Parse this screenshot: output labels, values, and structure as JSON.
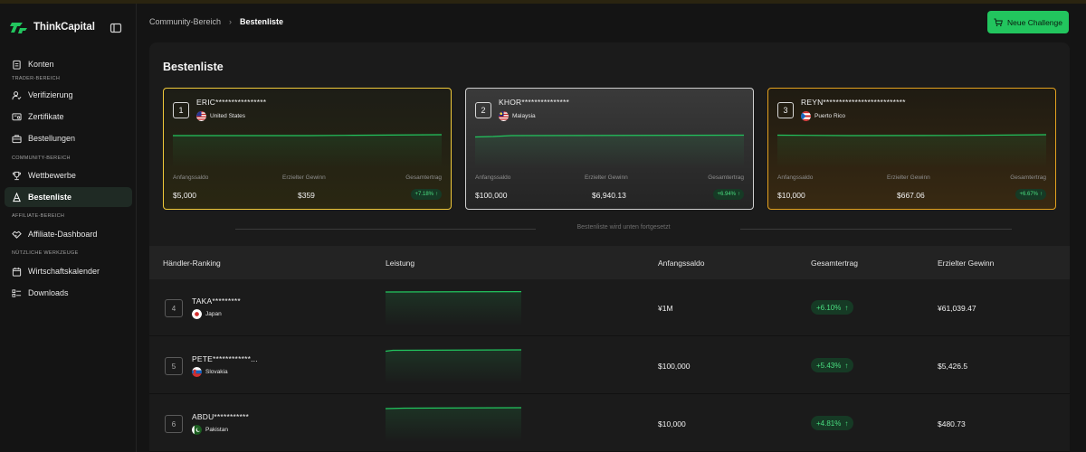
{
  "app": {
    "name": "ThinkCapital"
  },
  "sidebar": {
    "items": [
      {
        "label": "Konten",
        "icon": "clipboard-icon"
      },
      {
        "label": "Verifizierung",
        "icon": "user-check-icon"
      },
      {
        "label": "Zertifikate",
        "icon": "certificate-icon"
      },
      {
        "label": "Bestellungen",
        "icon": "briefcase-icon"
      },
      {
        "label": "Wettbewerbe",
        "icon": "trophy-icon"
      },
      {
        "label": "Bestenliste",
        "icon": "podium-icon",
        "active": true
      },
      {
        "label": "Affiliate-Dashboard",
        "icon": "handshake-icon"
      },
      {
        "label": "Wirtschaftskalender",
        "icon": "calendar-icon"
      },
      {
        "label": "Downloads",
        "icon": "list-icon"
      }
    ],
    "sections": [
      "TRADER-BEREICH",
      "COMMUNITY-BEREICH",
      "AFFILIATE-BEREICH",
      "NÜTZLICHE WERKZEUGE"
    ]
  },
  "breadcrumb": {
    "parent": "Community-Bereich",
    "current": "Bestenliste"
  },
  "new_challenge_label": "Neue Challenge",
  "page_title": "Bestenliste",
  "podium_labels": {
    "start": "Anfangssaldo",
    "profit": "Erzielter Gewinn",
    "return": "Gesamtertrag"
  },
  "top3": [
    {
      "rank": "1",
      "name": "ERIC****************",
      "country": "United States",
      "start": "$5,000",
      "profit": "$359",
      "return": "+7.18%"
    },
    {
      "rank": "2",
      "name": "KHOR***************",
      "country": "Malaysia",
      "start": "$100,000",
      "profit": "$6,940.13",
      "return": "+6.94%"
    },
    {
      "rank": "3",
      "name": "REYN**************************",
      "country": "Puerto Rico",
      "start": "$10,000",
      "profit": "$667.06",
      "return": "+6.67%"
    }
  ],
  "continuation_text": "Bestenliste wird unten fortgesetzt",
  "table": {
    "headers": [
      "Händler-Ranking",
      "Leistung",
      "Anfangssaldo",
      "Gesamtertrag",
      "Erzielter Gewinn"
    ],
    "rows": [
      {
        "rank": "4",
        "name": "TAKA*********",
        "country": "Japan",
        "start": "¥1M",
        "return": "+6.10%",
        "profit": "¥61,039.47"
      },
      {
        "rank": "5",
        "name": "PETE************...",
        "country": "Slovakia",
        "start": "$100,000",
        "return": "+5.43%",
        "profit": "$5,426.5"
      },
      {
        "rank": "6",
        "name": "ABDU***********",
        "country": "Pakistan",
        "start": "$10,000",
        "return": "+4.81%",
        "profit": "$480.73"
      }
    ]
  },
  "colors": {
    "accent": "#22c55e",
    "gold": "#f0c93a",
    "silver": "#cfcfcf",
    "bronze": "#e3a11f",
    "positive": "#4ade80"
  }
}
